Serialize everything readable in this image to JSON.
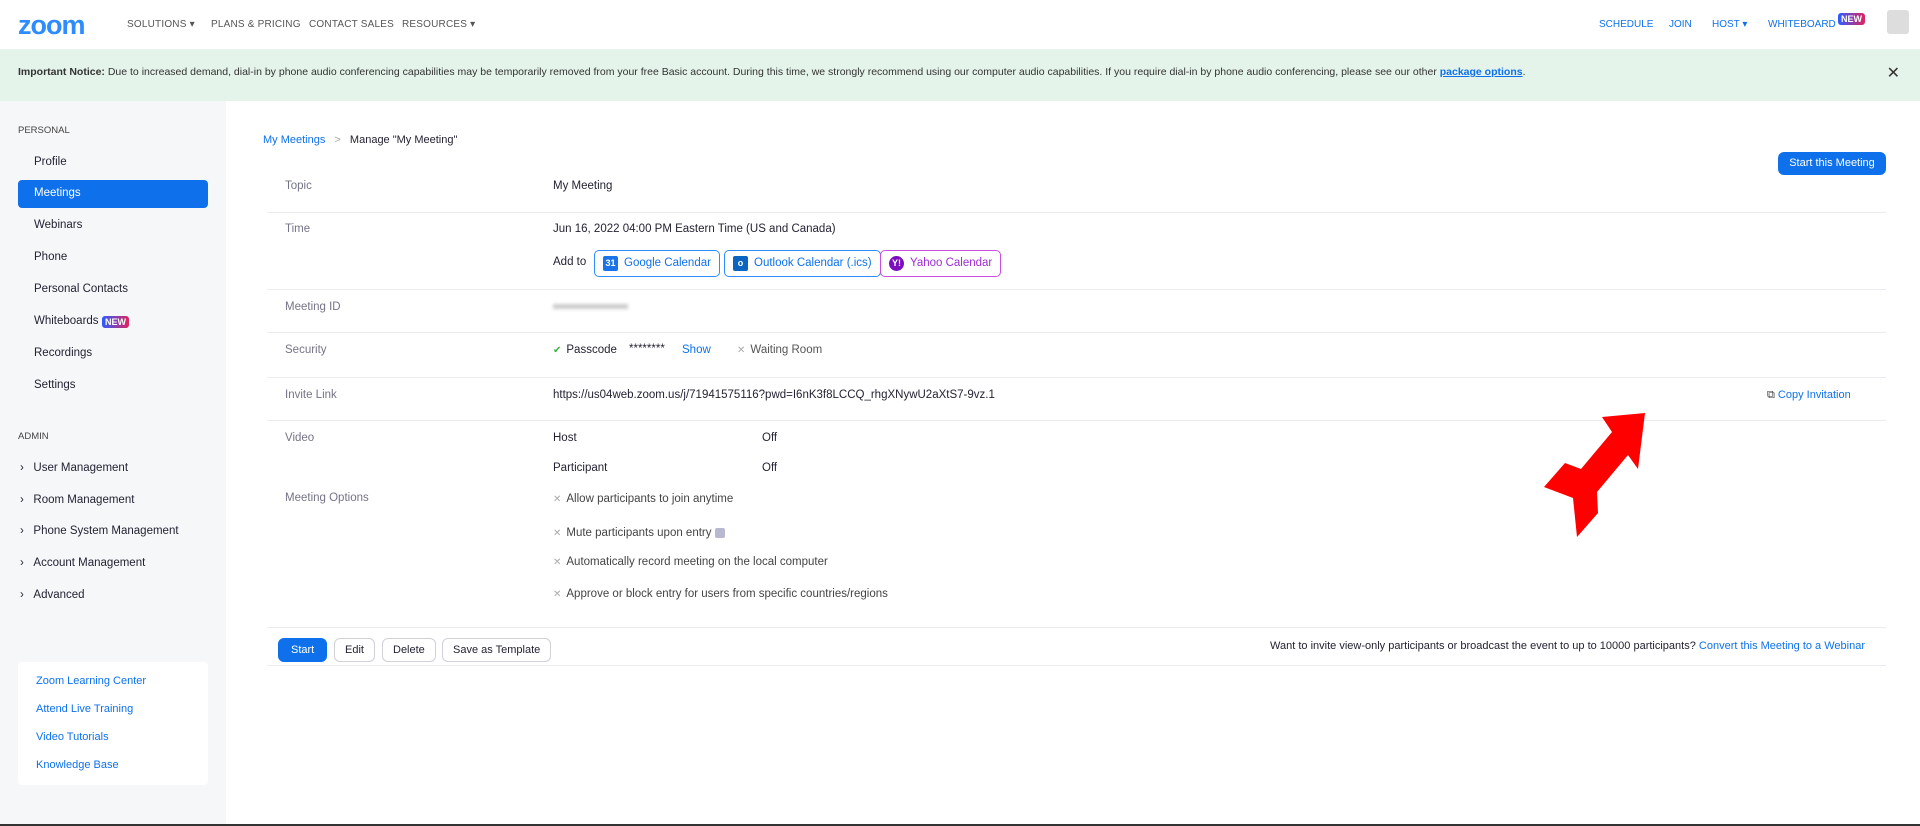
{
  "header": {
    "logo": "zoom",
    "nav_left": [
      "SOLUTIONS ▾",
      "PLANS & PRICING",
      "CONTACT SALES",
      "RESOURCES ▾"
    ],
    "nav_right": {
      "schedule": "SCHEDULE",
      "join": "JOIN",
      "host": "HOST ▾",
      "whiteboard": "WHITEBOARD",
      "new_badge": "NEW"
    }
  },
  "notice": {
    "bold": "Important Notice:",
    "text": " Due to increased demand, dial-in by phone audio conferencing capabilities may be temporarily removed from your free Basic account. During this time, we strongly recommend using our computer audio capabilities. If you require dial-in by phone audio conferencing, please see our other ",
    "link": "package options",
    "end": ".",
    "close": "✕"
  },
  "sidebar": {
    "personal_label": "PERSONAL",
    "personal": [
      "Profile",
      "Meetings",
      "Webinars",
      "Phone",
      "Personal Contacts",
      "Whiteboards",
      "Recordings",
      "Settings"
    ],
    "new_badge": "NEW",
    "admin_label": "ADMIN",
    "admin": [
      "User Management",
      "Room Management",
      "Phone System Management",
      "Account Management",
      "Advanced"
    ],
    "learning": [
      "Zoom Learning Center",
      "Attend Live Training",
      "Video Tutorials",
      "Knowledge Base"
    ]
  },
  "breadcrumb": {
    "parent": "My Meetings",
    "sep": ">",
    "current": "Manage \"My Meeting\""
  },
  "start_meeting": "Start this Meeting",
  "meeting": {
    "topic_label": "Topic",
    "topic": "My Meeting",
    "time_label": "Time",
    "time": "Jun 16, 2022 04:00 PM Eastern Time (US and Canada)",
    "add_to": "Add to",
    "calendars": [
      "Google Calendar",
      "Outlook Calendar (.ics)",
      "Yahoo Calendar"
    ],
    "id_label": "Meeting ID",
    "security_label": "Security",
    "passcode": "Passcode",
    "passcode_mask": "********",
    "show": "Show",
    "waiting_room": "Waiting Room",
    "invite_label": "Invite Link",
    "invite_url": "https://us04web.zoom.us/j/71941575116?pwd=I6nK3f8LCCQ_rhgXNywU2aXtS7-9vz.1",
    "copy_invitation": "Copy Invitation",
    "video_label": "Video",
    "host": "Host",
    "host_val": "Off",
    "participant": "Participant",
    "participant_val": "Off",
    "options_label": "Meeting Options",
    "options": [
      "Allow participants to join anytime",
      "Mute participants upon entry",
      "Automatically record meeting on the local computer",
      "Approve or block entry for users from specific countries/regions"
    ]
  },
  "actions": {
    "start": "Start",
    "edit": "Edit",
    "delete": "Delete",
    "save_template": "Save as Template"
  },
  "webinar": {
    "text": "Want to invite view-only participants or broadcast the event to up to 10000 participants?",
    "link": "Convert this Meeting to a Webinar"
  },
  "colors": {
    "accent": "#0e71eb",
    "notice_bg": "#e4f4ea",
    "arrow": "#ff0000"
  }
}
